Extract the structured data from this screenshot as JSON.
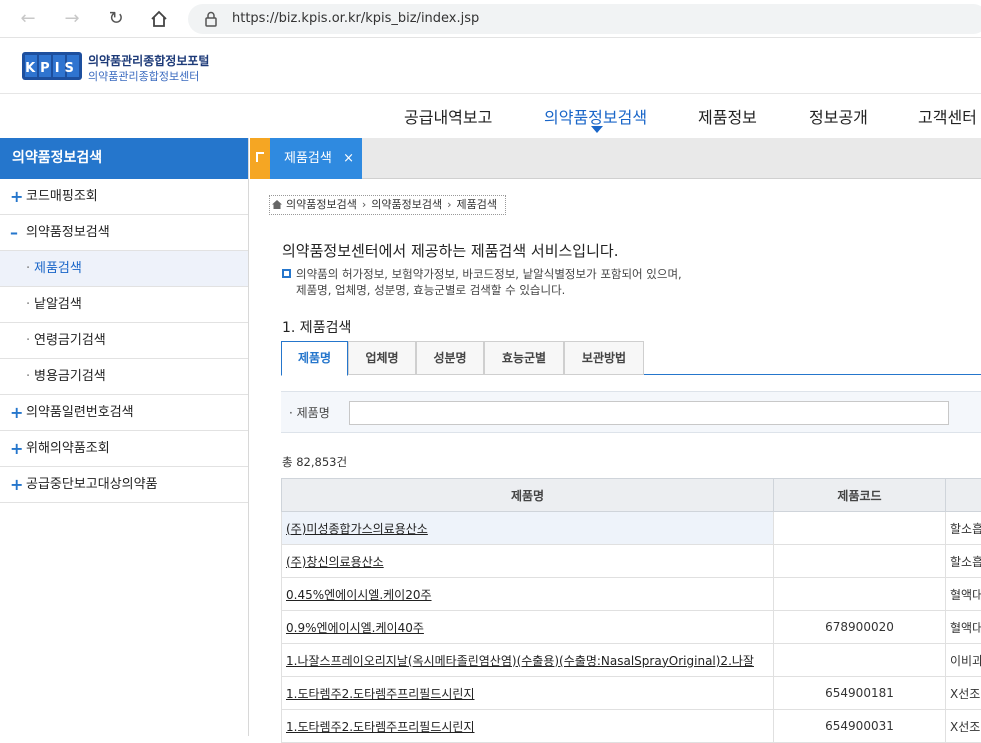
{
  "browser": {
    "url": "https://biz.kpis.or.kr/kpis_biz/index.jsp"
  },
  "site": {
    "logo_text": "KPIS",
    "title": "의약품관리종합정보포털",
    "subtitle": "의약품관리종합정보센터"
  },
  "top_nav": {
    "items": [
      "공급내역보고",
      "의약품정보검색",
      "제품정보",
      "정보공개",
      "고객센터"
    ],
    "active_index": 1
  },
  "sidebar": {
    "title": "의약품정보검색",
    "items": [
      {
        "label": "코드매핑조회",
        "type": "plus"
      },
      {
        "label": "의약품정보검색",
        "type": "minus"
      },
      {
        "label": "제품검색",
        "type": "sub",
        "current": true
      },
      {
        "label": "낱알검색",
        "type": "sub"
      },
      {
        "label": "연령금기검색",
        "type": "sub"
      },
      {
        "label": "병용금기검색",
        "type": "sub"
      },
      {
        "label": "의약품일련번호검색",
        "type": "plus"
      },
      {
        "label": "위해의약품조회",
        "type": "plus"
      },
      {
        "label": "공급중단보고대상의약품",
        "type": "plus"
      }
    ]
  },
  "tab_strip": {
    "active_tab": "제품검색",
    "close_symbol": "×"
  },
  "breadcrumb": [
    "의약품정보검색",
    "의약품정보검색",
    "제품검색"
  ],
  "intro": {
    "title": "의약품정보센터에서 제공하는 제품검색 서비스입니다.",
    "desc_line1": "의약품의 허가정보, 보험약가정보, 바코드정보, 낱알식별정보가 포함되어 있으며,",
    "desc_line2": "제품명, 업체명, 성분명, 효능군별로 검색할 수 있습니다."
  },
  "section_title": "1. 제품검색",
  "search_tabs": [
    "제품명",
    "업체명",
    "성분명",
    "효능군별",
    "보관방법"
  ],
  "search": {
    "label": "제품명",
    "value": ""
  },
  "total": "총 82,853건",
  "table": {
    "headers": [
      "제품명",
      "제품코드",
      ""
    ],
    "rows": [
      {
        "name": "(주)미성종합가스의료용산소",
        "code": "",
        "extra": "할소흡"
      },
      {
        "name": "(주)창신의료용산소",
        "code": "",
        "extra": "할소흡"
      },
      {
        "name": "0.45%엔에이시엘.케이20주",
        "code": "",
        "extra": "혈액대"
      },
      {
        "name": "0.9%엔에이시엘.케이40주",
        "code": "678900020",
        "extra": "혈액대"
      },
      {
        "name": "1.나잘스프레이오리지날(옥시메타졸린염산염)(수출용)(수출명:NasalSprayOriginal)2.나잘",
        "code": "",
        "extra": "이비과"
      },
      {
        "name": "1.도타렘주2.도타렘주프리필드시린지",
        "code": "654900181",
        "extra": "X선조"
      },
      {
        "name": "1.도타렘주2.도타렘주프리필드시린지",
        "code": "654900031",
        "extra": "X선조"
      }
    ]
  },
  "colors": {
    "accent": "#2576cc",
    "tab_active": "#2f8ae0",
    "tab_handle": "#f5a623"
  }
}
